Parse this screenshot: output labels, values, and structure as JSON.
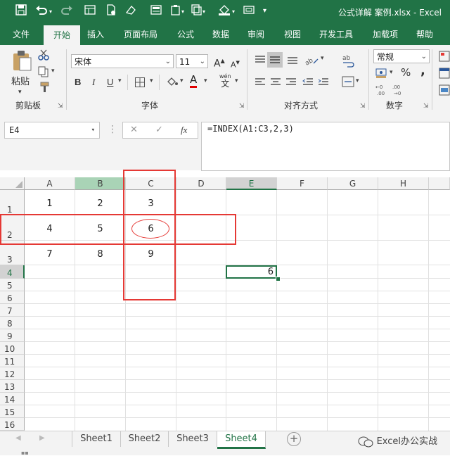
{
  "window": {
    "title": "公式详解 案例.xlsx  -  Excel"
  },
  "quick_access": [
    "save-icon",
    "undo-icon",
    "redo-icon",
    "form-icon",
    "new-icon",
    "clear-icon",
    "calculator-icon",
    "paste-icon",
    "copy-icon",
    "fill-icon",
    "window-icon",
    "more-icon"
  ],
  "tabs": [
    "文件",
    "开始",
    "插入",
    "页面布局",
    "公式",
    "数据",
    "审阅",
    "视图",
    "开发工具",
    "加载项",
    "帮助"
  ],
  "ribbon": {
    "clipboard": {
      "paste_label": "粘贴",
      "group_label": "剪贴板"
    },
    "font": {
      "font_name": "宋体",
      "font_size": "11",
      "bold": "B",
      "italic": "I",
      "underline": "U",
      "grow": "A",
      "shrink": "A",
      "color_letter": "A",
      "wen": "wén",
      "group_label": "字体"
    },
    "alignment": {
      "group_label": "对齐方式"
    },
    "number": {
      "format": "常规",
      "percent": "%",
      "comma": ",",
      "group_label": "数字"
    }
  },
  "formula_bar": {
    "name_box": "E4",
    "cancel": "✕",
    "enter": "✓",
    "fx": "fx",
    "formula": "=INDEX(A1:C3,2,3)"
  },
  "columns": [
    "A",
    "B",
    "C",
    "D",
    "E",
    "F",
    "G",
    "H"
  ],
  "rows": [
    "1",
    "2",
    "3",
    "4",
    "5",
    "6",
    "7",
    "8",
    "9",
    "10",
    "11",
    "12",
    "13",
    "14",
    "15",
    "16"
  ],
  "cells": {
    "A1": "1",
    "B1": "2",
    "C1": "3",
    "A2": "4",
    "B2": "5",
    "C2": "6",
    "A3": "7",
    "B3": "8",
    "C3": "9",
    "E4": "6"
  },
  "sheets": [
    "Sheet1",
    "Sheet2",
    "Sheet3",
    "Sheet4"
  ],
  "active_sheet": "Sheet4",
  "watermark": "Excel办公实战",
  "colors": {
    "brand": "#217346",
    "highlight": "#e53935",
    "ribbon_bg": "#f3f3f3"
  }
}
